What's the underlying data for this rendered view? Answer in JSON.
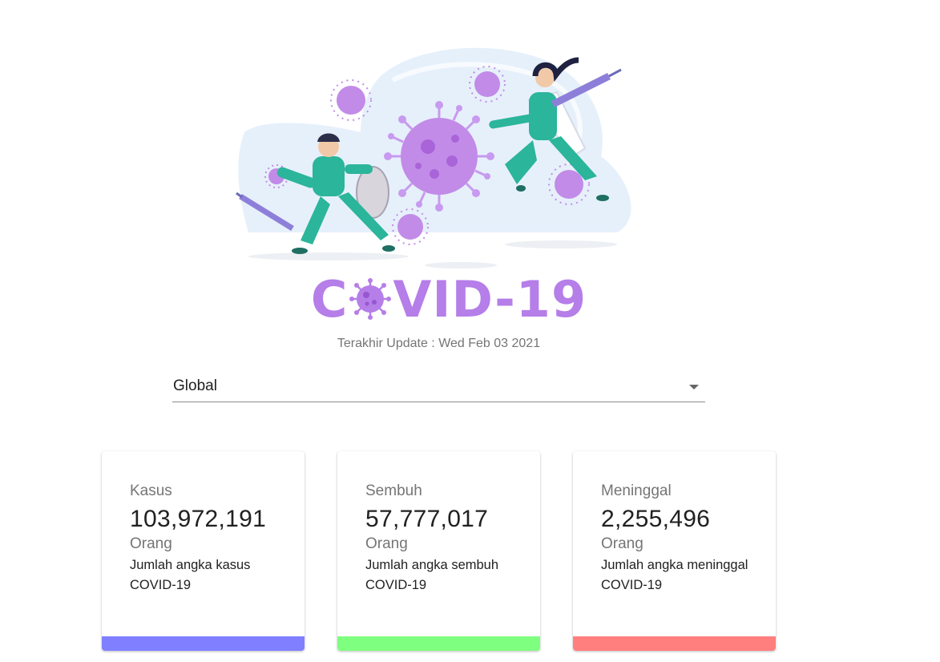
{
  "logo": {
    "text_before": "C",
    "text_after": "VID-19",
    "color": "#b57ee8"
  },
  "last_update": {
    "label": "Terakhir Update : ",
    "date": "Wed Feb 03 2021"
  },
  "region_select": {
    "selected": "Global"
  },
  "cards": [
    {
      "label": "Kasus",
      "value": "103,972,191",
      "unit": "Orang",
      "description": "Jumlah angka kasus COVID-19",
      "accent_color": "#7f7fff"
    },
    {
      "label": "Sembuh",
      "value": "57,777,017",
      "unit": "Orang",
      "description": "Jumlah angka sembuh COVID-19",
      "accent_color": "#7fff7f"
    },
    {
      "label": "Meninggal",
      "value": "2,255,496",
      "unit": "Orang",
      "description": "Jumlah angka meninggal COVID-19",
      "accent_color": "#ff7f7f"
    }
  ],
  "icons": {
    "hero": "doctors-fighting-virus-illustration",
    "logo_virus": "virus-icon",
    "select_arrow": "caret-down-icon"
  }
}
